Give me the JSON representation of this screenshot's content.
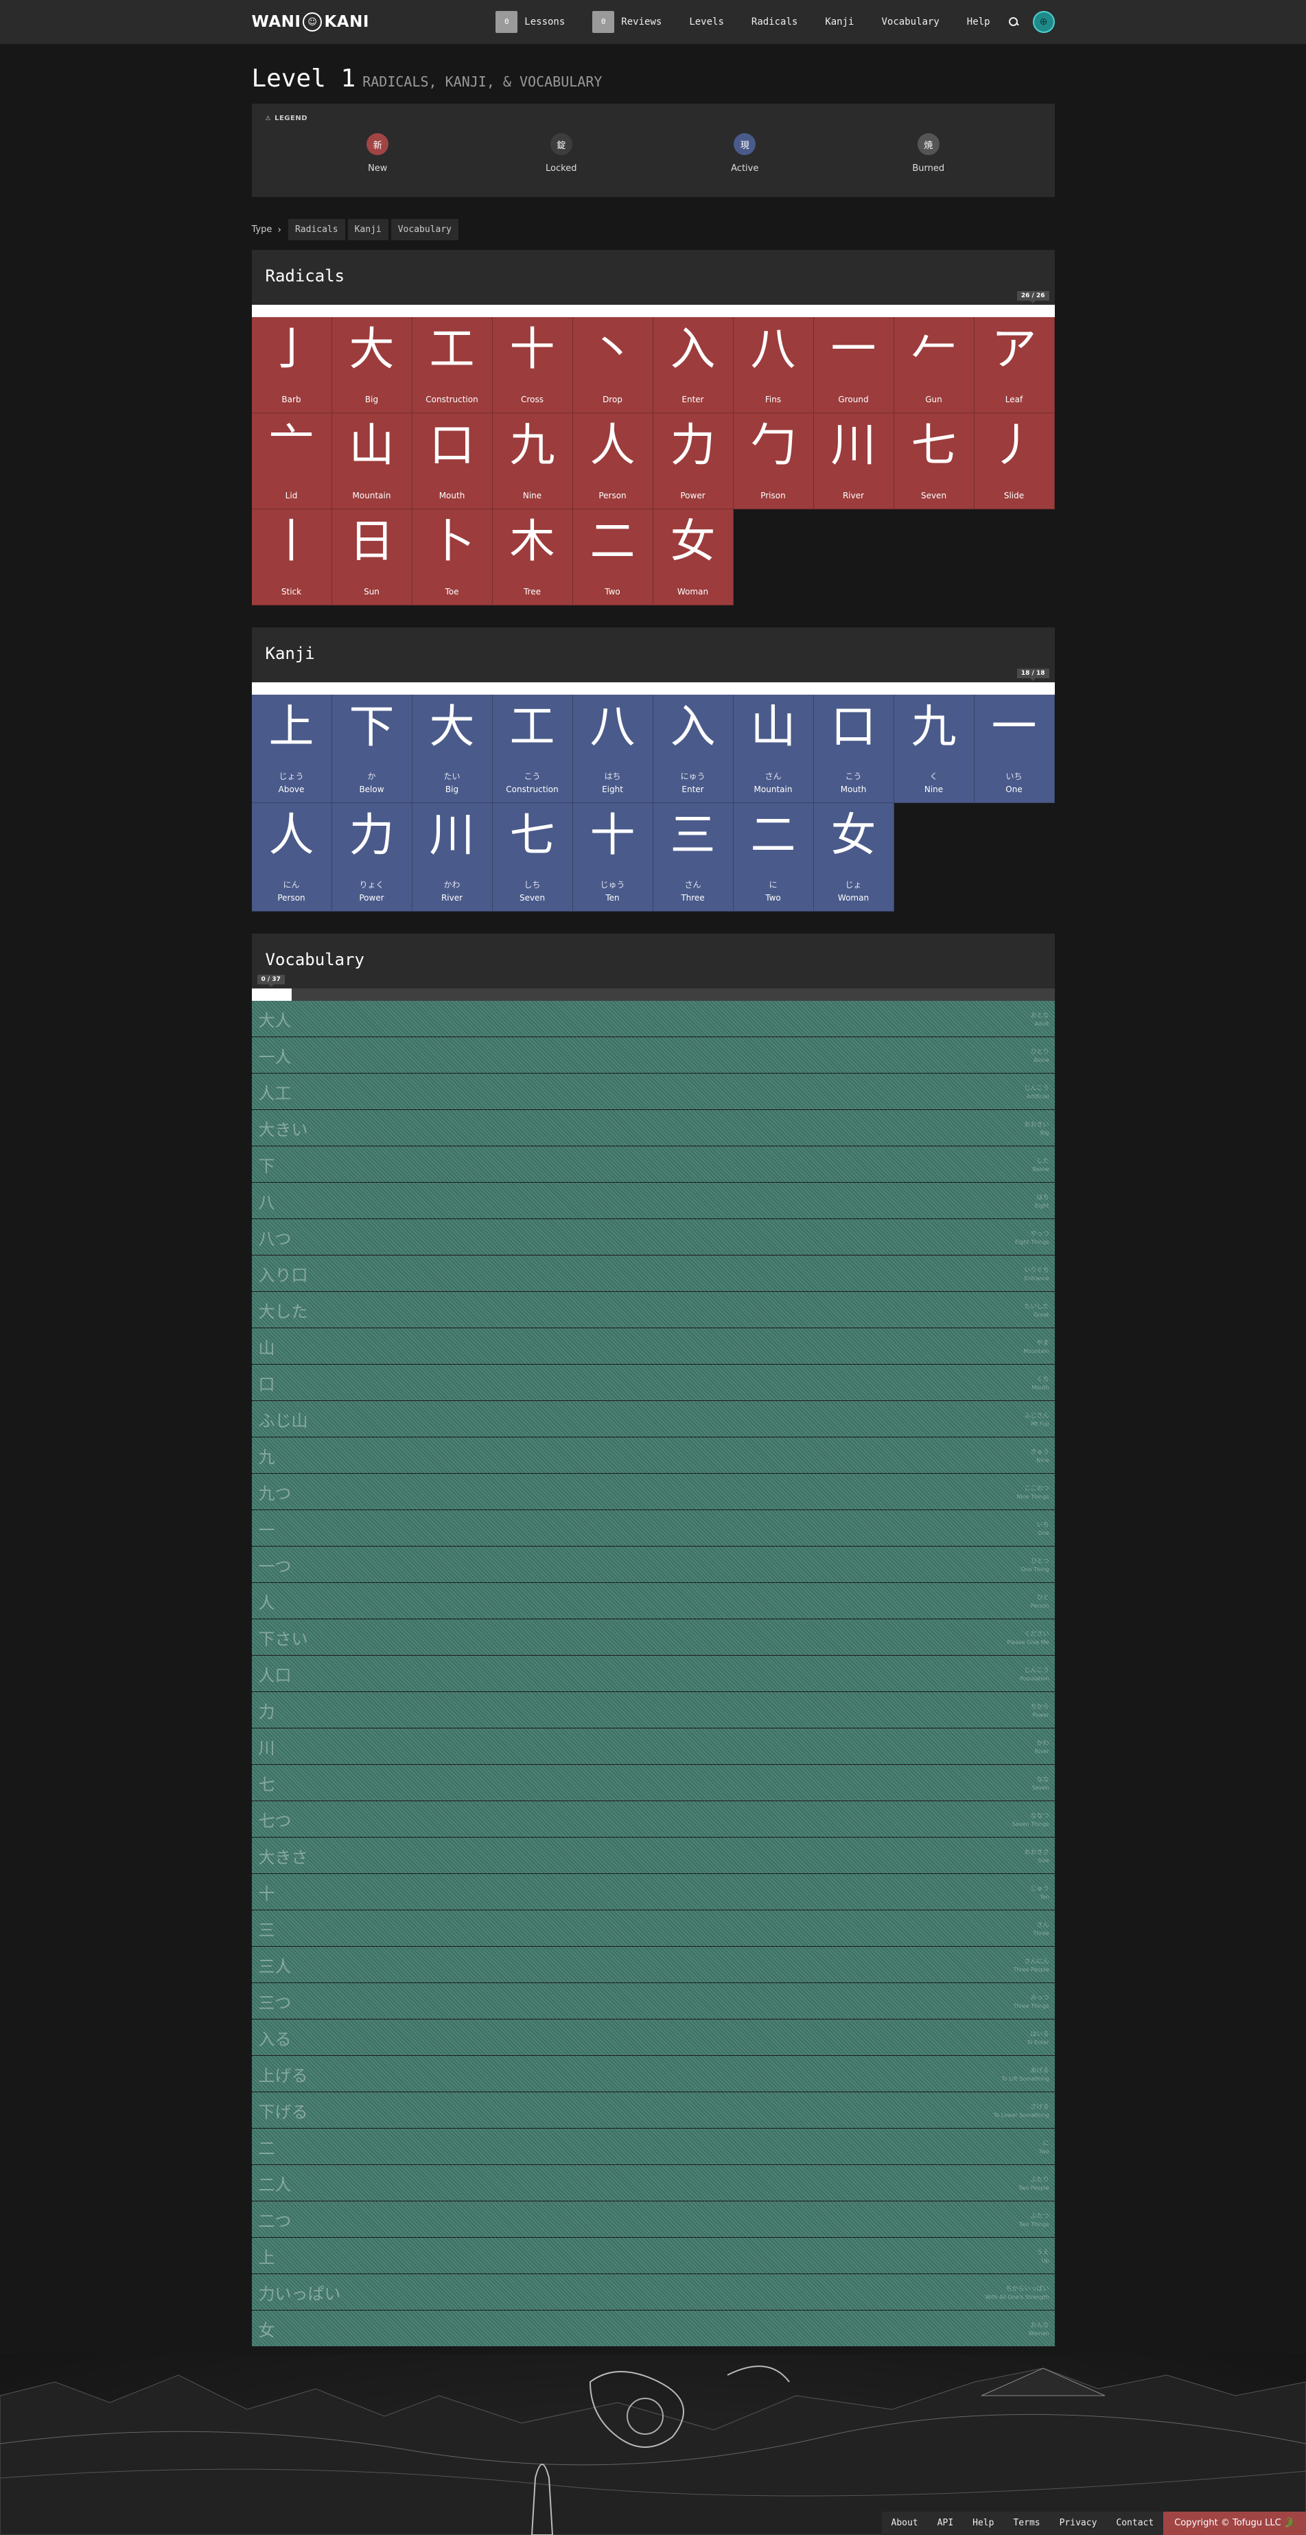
{
  "nav": {
    "logo_left": "WANI",
    "logo_right": "KANI",
    "lessons_label": "Lessons",
    "lessons_count": "0",
    "reviews_label": "Reviews",
    "reviews_count": "0",
    "levels_label": "Levels",
    "radicals_label": "Radicals",
    "kanji_label": "Kanji",
    "vocabulary_label": "Vocabulary",
    "help_label": "Help"
  },
  "page": {
    "title": "Level 1",
    "subtitle": "RADICALS, KANJI, & VOCABULARY"
  },
  "legend": {
    "title": "LEGEND",
    "items": [
      {
        "glyph": "新",
        "label": "New",
        "color": "#a14444"
      },
      {
        "glyph": "錠",
        "label": "Locked",
        "color": "#3d3d3d"
      },
      {
        "glyph": "現",
        "label": "Active",
        "color": "#4a5a8a"
      },
      {
        "glyph": "焼",
        "label": "Burned",
        "color": "#555555"
      }
    ]
  },
  "filter": {
    "label": "Type",
    "buttons": [
      "Radicals",
      "Kanji",
      "Vocabulary"
    ]
  },
  "radicals": {
    "title": "Radicals",
    "progress": "26 / 26",
    "progress_fraction": 1.0,
    "items": [
      {
        "ch": "亅",
        "meaning": "Barb"
      },
      {
        "ch": "大",
        "meaning": "Big"
      },
      {
        "ch": "工",
        "meaning": "Construction"
      },
      {
        "ch": "十",
        "meaning": "Cross"
      },
      {
        "ch": "丶",
        "meaning": "Drop"
      },
      {
        "ch": "入",
        "meaning": "Enter"
      },
      {
        "ch": "八",
        "meaning": "Fins"
      },
      {
        "ch": "一",
        "meaning": "Ground"
      },
      {
        "ch": "𠂉",
        "meaning": "Gun"
      },
      {
        "ch": "ア",
        "meaning": "Leaf"
      },
      {
        "ch": "亠",
        "meaning": "Lid"
      },
      {
        "ch": "山",
        "meaning": "Mountain"
      },
      {
        "ch": "口",
        "meaning": "Mouth"
      },
      {
        "ch": "九",
        "meaning": "Nine"
      },
      {
        "ch": "人",
        "meaning": "Person"
      },
      {
        "ch": "力",
        "meaning": "Power"
      },
      {
        "ch": "勹",
        "meaning": "Prison"
      },
      {
        "ch": "川",
        "meaning": "River"
      },
      {
        "ch": "七",
        "meaning": "Seven"
      },
      {
        "ch": "丿",
        "meaning": "Slide"
      },
      {
        "ch": "丨",
        "meaning": "Stick"
      },
      {
        "ch": "日",
        "meaning": "Sun"
      },
      {
        "ch": "卜",
        "meaning": "Toe"
      },
      {
        "ch": "木",
        "meaning": "Tree"
      },
      {
        "ch": "二",
        "meaning": "Two"
      },
      {
        "ch": "女",
        "meaning": "Woman"
      }
    ]
  },
  "kanji": {
    "title": "Kanji",
    "progress": "18 / 18",
    "progress_fraction": 1.0,
    "items": [
      {
        "ch": "上",
        "reading": "じょう",
        "meaning": "Above"
      },
      {
        "ch": "下",
        "reading": "か",
        "meaning": "Below"
      },
      {
        "ch": "大",
        "reading": "たい",
        "meaning": "Big"
      },
      {
        "ch": "工",
        "reading": "こう",
        "meaning": "Construction"
      },
      {
        "ch": "八",
        "reading": "はち",
        "meaning": "Eight"
      },
      {
        "ch": "入",
        "reading": "にゅう",
        "meaning": "Enter"
      },
      {
        "ch": "山",
        "reading": "さん",
        "meaning": "Mountain"
      },
      {
        "ch": "口",
        "reading": "こう",
        "meaning": "Mouth"
      },
      {
        "ch": "九",
        "reading": "く",
        "meaning": "Nine"
      },
      {
        "ch": "一",
        "reading": "いち",
        "meaning": "One"
      },
      {
        "ch": "人",
        "reading": "にん",
        "meaning": "Person"
      },
      {
        "ch": "力",
        "reading": "りょく",
        "meaning": "Power"
      },
      {
        "ch": "川",
        "reading": "かわ",
        "meaning": "River"
      },
      {
        "ch": "七",
        "reading": "しち",
        "meaning": "Seven"
      },
      {
        "ch": "十",
        "reading": "じゅう",
        "meaning": "Ten"
      },
      {
        "ch": "三",
        "reading": "さん",
        "meaning": "Three"
      },
      {
        "ch": "二",
        "reading": "に",
        "meaning": "Two"
      },
      {
        "ch": "女",
        "reading": "じょ",
        "meaning": "Woman"
      }
    ]
  },
  "vocabulary": {
    "title": "Vocabulary",
    "progress": "0 / 37",
    "progress_fraction": 0.05,
    "items": [
      {
        "ch": "大人",
        "reading": "おとな",
        "meaning": "Adult"
      },
      {
        "ch": "一人",
        "reading": "ひとり",
        "meaning": "Alone"
      },
      {
        "ch": "人工",
        "reading": "じんこう",
        "meaning": "Artificial"
      },
      {
        "ch": "大きい",
        "reading": "おおきい",
        "meaning": "Big"
      },
      {
        "ch": "下",
        "reading": "した",
        "meaning": "Below"
      },
      {
        "ch": "八",
        "reading": "はち",
        "meaning": "Eight"
      },
      {
        "ch": "八つ",
        "reading": "やっつ",
        "meaning": "Eight Things"
      },
      {
        "ch": "入り口",
        "reading": "いりぐち",
        "meaning": "Entrance"
      },
      {
        "ch": "大した",
        "reading": "たいした",
        "meaning": "Great"
      },
      {
        "ch": "山",
        "reading": "やま",
        "meaning": "Mountain"
      },
      {
        "ch": "口",
        "reading": "くち",
        "meaning": "Mouth"
      },
      {
        "ch": "ふじ山",
        "reading": "ふじさん",
        "meaning": "Mt Fuji"
      },
      {
        "ch": "九",
        "reading": "きゅう",
        "meaning": "Nine"
      },
      {
        "ch": "九つ",
        "reading": "ここのつ",
        "meaning": "Nine Things"
      },
      {
        "ch": "一",
        "reading": "いち",
        "meaning": "One"
      },
      {
        "ch": "一つ",
        "reading": "ひとつ",
        "meaning": "One Thing"
      },
      {
        "ch": "人",
        "reading": "ひと",
        "meaning": "Person"
      },
      {
        "ch": "下さい",
        "reading": "ください",
        "meaning": "Please Give Me"
      },
      {
        "ch": "人口",
        "reading": "じんこう",
        "meaning": "Population"
      },
      {
        "ch": "力",
        "reading": "ちから",
        "meaning": "Power"
      },
      {
        "ch": "川",
        "reading": "かわ",
        "meaning": "River"
      },
      {
        "ch": "七",
        "reading": "なな",
        "meaning": "Seven"
      },
      {
        "ch": "七つ",
        "reading": "ななつ",
        "meaning": "Seven Things"
      },
      {
        "ch": "大きさ",
        "reading": "おおきさ",
        "meaning": "Size"
      },
      {
        "ch": "十",
        "reading": "じゅう",
        "meaning": "Ten"
      },
      {
        "ch": "三",
        "reading": "さん",
        "meaning": "Three"
      },
      {
        "ch": "三人",
        "reading": "さんにん",
        "meaning": "Three People"
      },
      {
        "ch": "三つ",
        "reading": "みっつ",
        "meaning": "Three Things"
      },
      {
        "ch": "入る",
        "reading": "はいる",
        "meaning": "To Enter"
      },
      {
        "ch": "上げる",
        "reading": "あげる",
        "meaning": "To Lift Something"
      },
      {
        "ch": "下げる",
        "reading": "さげる",
        "meaning": "To Lower Something"
      },
      {
        "ch": "二",
        "reading": "に",
        "meaning": "Two"
      },
      {
        "ch": "二人",
        "reading": "ふたり",
        "meaning": "Two People"
      },
      {
        "ch": "二つ",
        "reading": "ふたつ",
        "meaning": "Two Things"
      },
      {
        "ch": "上",
        "reading": "うえ",
        "meaning": "Up"
      },
      {
        "ch": "力いっぱい",
        "reading": "ちからいっぱい",
        "meaning": "With All One's Strength"
      },
      {
        "ch": "女",
        "reading": "おんな",
        "meaning": "Woman"
      }
    ]
  },
  "footer": {
    "links": [
      "About",
      "API",
      "Help",
      "Terms",
      "Privacy",
      "Contact"
    ],
    "copyright": "Copyright © Tofugu LLC 🐊"
  },
  "colors": {
    "radical": "#9c3c3c",
    "kanji": "#4a5a8a",
    "vocab": "#3f6e62"
  }
}
